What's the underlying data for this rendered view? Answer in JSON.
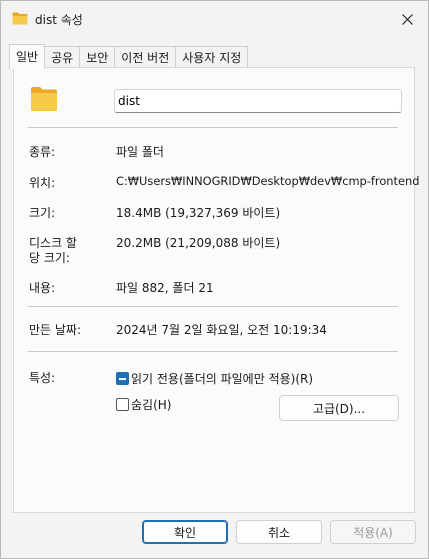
{
  "window": {
    "title": "dist 속성",
    "icons": {
      "title": "folder-icon",
      "close": "close-icon",
      "large": "folder-icon"
    }
  },
  "tabs": [
    {
      "label": "일반",
      "active": true
    },
    {
      "label": "공유",
      "active": false
    },
    {
      "label": "보안",
      "active": false
    },
    {
      "label": "이전 버전",
      "active": false
    },
    {
      "label": "사용자 지정",
      "active": false
    }
  ],
  "general": {
    "name": "dist",
    "type_label": "종류:",
    "type_value": "파일 폴더",
    "location_label": "위치:",
    "location_value": "C:₩Users₩INNOGRID₩Desktop₩dev₩cmp-frontend",
    "size_label": "크기:",
    "size_value": "18.4MB (19,327,369 바이트)",
    "disk_label_line1": "디스크 할",
    "disk_label_line2": "당 크기:",
    "disk_value": "20.2MB (21,209,088 바이트)",
    "contents_label": "내용:",
    "contents_value": "파일 882, 폴더 21",
    "created_label": "만든 날짜:",
    "created_value": "2024년 7월 2일 화요일, 오전 10:19:34",
    "attributes_label": "특성:",
    "readonly_label": "읽기 전용(폴더의 파일에만 적용)(R)",
    "readonly_state": "indeterminate",
    "hidden_label": "숨김(H)",
    "hidden_state": "unchecked",
    "advanced_label": "고급(D)..."
  },
  "footer": {
    "ok_label": "확인",
    "cancel_label": "취소",
    "apply_label": "적용(A)"
  },
  "colors": {
    "accent": "#1f6fb5",
    "folder": "#f5c342"
  }
}
